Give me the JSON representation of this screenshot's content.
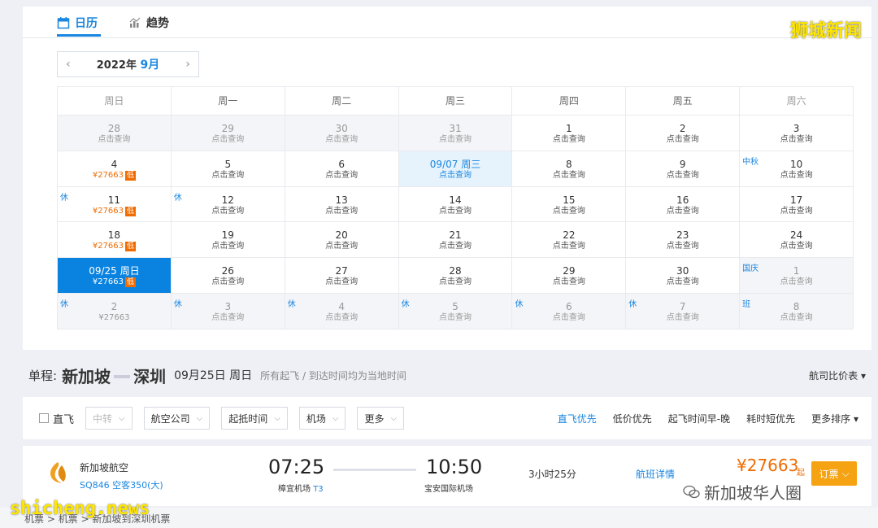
{
  "tabs": [
    {
      "label": "日历",
      "icon": "calendar-icon"
    },
    {
      "label": "趋势",
      "icon": "chart-icon"
    }
  ],
  "watermark_top": "狮城新闻",
  "calendar": {
    "year_label": "2022年",
    "month_label": "9月",
    "weekdays": [
      "周日",
      "周一",
      "周二",
      "周三",
      "周四",
      "周五",
      "周六"
    ],
    "weeks": [
      [
        {
          "day": "28",
          "sub": "点击查询",
          "other": true
        },
        {
          "day": "29",
          "sub": "点击查询",
          "other": true
        },
        {
          "day": "30",
          "sub": "点击查询",
          "other": true
        },
        {
          "day": "31",
          "sub": "点击查询",
          "other": true
        },
        {
          "day": "1",
          "sub": "点击查询"
        },
        {
          "day": "2",
          "sub": "点击查询"
        },
        {
          "day": "3",
          "sub": "点击查询"
        }
      ],
      [
        {
          "day": "4",
          "sub": "¥27663",
          "low": "低"
        },
        {
          "day": "5",
          "sub": "点击查询"
        },
        {
          "day": "6",
          "sub": "点击查询"
        },
        {
          "day": "09/07 周三",
          "sub": "点击查询",
          "today": true
        },
        {
          "day": "8",
          "sub": "点击查询"
        },
        {
          "day": "9",
          "sub": "点击查询"
        },
        {
          "day": "10",
          "sub": "点击查询",
          "tag": "中秋"
        }
      ],
      [
        {
          "day": "11",
          "sub": "¥27663",
          "low": "低",
          "tag": "休"
        },
        {
          "day": "12",
          "sub": "点击查询",
          "tag": "休"
        },
        {
          "day": "13",
          "sub": "点击查询"
        },
        {
          "day": "14",
          "sub": "点击查询"
        },
        {
          "day": "15",
          "sub": "点击查询"
        },
        {
          "day": "16",
          "sub": "点击查询"
        },
        {
          "day": "17",
          "sub": "点击查询"
        }
      ],
      [
        {
          "day": "18",
          "sub": "¥27663",
          "low": "低"
        },
        {
          "day": "19",
          "sub": "点击查询"
        },
        {
          "day": "20",
          "sub": "点击查询"
        },
        {
          "day": "21",
          "sub": "点击查询"
        },
        {
          "day": "22",
          "sub": "点击查询"
        },
        {
          "day": "23",
          "sub": "点击查询"
        },
        {
          "day": "24",
          "sub": "点击查询"
        }
      ],
      [
        {
          "day": "09/25 周日",
          "sub": "¥27663",
          "low": "低",
          "selected": true
        },
        {
          "day": "26",
          "sub": "点击查询"
        },
        {
          "day": "27",
          "sub": "点击查询"
        },
        {
          "day": "28",
          "sub": "点击查询"
        },
        {
          "day": "29",
          "sub": "点击查询"
        },
        {
          "day": "30",
          "sub": "点击查询"
        },
        {
          "day": "1",
          "sub": "点击查询",
          "other": true,
          "tag": "国庆"
        }
      ],
      [
        {
          "day": "2",
          "sub": "¥27663",
          "other": true,
          "tag": "休"
        },
        {
          "day": "3",
          "sub": "点击查询",
          "other": true,
          "tag": "休"
        },
        {
          "day": "4",
          "sub": "点击查询",
          "other": true,
          "tag": "休"
        },
        {
          "day": "5",
          "sub": "点击查询",
          "other": true,
          "tag": "休"
        },
        {
          "day": "6",
          "sub": "点击查询",
          "other": true,
          "tag": "休"
        },
        {
          "day": "7",
          "sub": "点击查询",
          "other": true,
          "tag": "休"
        },
        {
          "day": "8",
          "sub": "点击查询",
          "other": true,
          "tag": "班"
        }
      ]
    ]
  },
  "trip": {
    "label": "单程:",
    "from": "新加坡",
    "to": "深圳",
    "date": "09月25日 周日",
    "note": "所有起飞 / 到达时间均为当地时间",
    "compare": "航司比价表 ▾"
  },
  "filters": {
    "direct": "直飞",
    "dropdowns": [
      {
        "label": "中转",
        "disabled": true
      },
      {
        "label": "航空公司"
      },
      {
        "label": "起抵时间"
      },
      {
        "label": "机场"
      },
      {
        "label": "更多"
      }
    ],
    "sorts": [
      {
        "label": "直飞优先",
        "active": true
      },
      {
        "label": "低价优先"
      },
      {
        "label": "起飞时间早-晚"
      },
      {
        "label": "耗时短优先"
      },
      {
        "label": "更多排序 ▾"
      }
    ]
  },
  "flight": {
    "airline": "新加坡航空",
    "flight_no": "SQ846 空客350(大)",
    "dep_time": "07:25",
    "dep_airport": "樟宜机场",
    "dep_terminal": "T3",
    "arr_time": "10:50",
    "arr_airport": "宝安国际机场",
    "duration": "3小时25分",
    "details": "航班详情",
    "price": "¥27663",
    "price_suffix": "起",
    "book": "订票"
  },
  "watermark_wechat": "新加坡华人圈",
  "watermark_bottom": "shicheng.news",
  "breadcrumb": "机票 > 机票 > 新加坡到深圳机票",
  "colors": {
    "accent": "#1a86e0",
    "price": "#f06b00",
    "book": "#f5a213"
  }
}
